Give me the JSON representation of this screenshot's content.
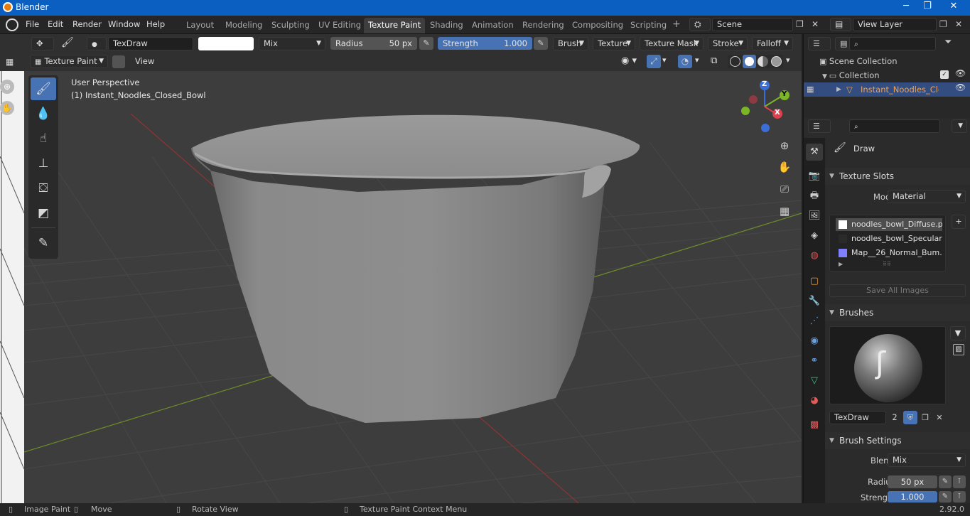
{
  "window": {
    "title": "Blender",
    "minimize": "─",
    "maximize": "❐",
    "close": "✕"
  },
  "menu": {
    "items": [
      "File",
      "Edit",
      "Render",
      "Window",
      "Help"
    ],
    "workspaces": [
      "Layout",
      "Modeling",
      "Sculpting",
      "UV Editing",
      "Texture Paint",
      "Shading",
      "Animation",
      "Rendering",
      "Compositing",
      "Scripting"
    ],
    "active_workspace": "Texture Paint",
    "add_workspace": "+",
    "scene": "Scene",
    "view_layer": "View Layer"
  },
  "tool_header": {
    "brush_name": "TexDraw",
    "blend": "Mix",
    "radius_label": "Radius",
    "radius_value": "50 px",
    "strength_label": "Strength",
    "strength_value": "1.000",
    "strength_fraction": 1.0,
    "menus": [
      "Brush",
      "Texture",
      "Texture Mask",
      "Stroke",
      "Falloff"
    ],
    "color_hex": "#ffffff"
  },
  "view_header": {
    "mode": "Texture Paint",
    "view_menu": "View"
  },
  "viewport": {
    "perspective": "User Perspective",
    "object_label": "(1) Instant_Noodles_Closed_Bowl",
    "gizmo": {
      "z": "Z",
      "y": "Y",
      "x": "X"
    }
  },
  "outliner": {
    "scene_collection": "Scene Collection",
    "collection": "Collection",
    "object": "Instant_Noodles_Clos"
  },
  "properties": {
    "active_tool": "Draw",
    "texture_slots": {
      "title": "Texture Slots",
      "mode_label": "Mode",
      "mode_value": "Material",
      "slots": [
        {
          "name": "noodles_bowl_Diffuse.p...",
          "color": "#ffffff"
        },
        {
          "name": "noodles_bowl_Specular....",
          "color": "#2a2a2a"
        },
        {
          "name": "Map__26_Normal_Bum...",
          "color": "#8080ff"
        }
      ],
      "save_all": "Save All Images"
    },
    "brushes": {
      "title": "Brushes",
      "brush_name": "TexDraw",
      "users": "2"
    },
    "brush_settings": {
      "title": "Brush Settings",
      "blend_label": "Blend",
      "blend_value": "Mix",
      "radius_label": "Radius",
      "radius_value": "50 px",
      "strength_label": "Strength",
      "strength_value": "1.000"
    }
  },
  "statusbar": {
    "left_action": "Image Paint",
    "middle_action": "Move",
    "right_action": "Rotate View",
    "context": "Texture Paint Context Menu",
    "version": "2.92.0"
  },
  "colors": {
    "accent": "#4772b3",
    "titlebar": "#0a5fc0",
    "active_object": "#e8a25a"
  }
}
